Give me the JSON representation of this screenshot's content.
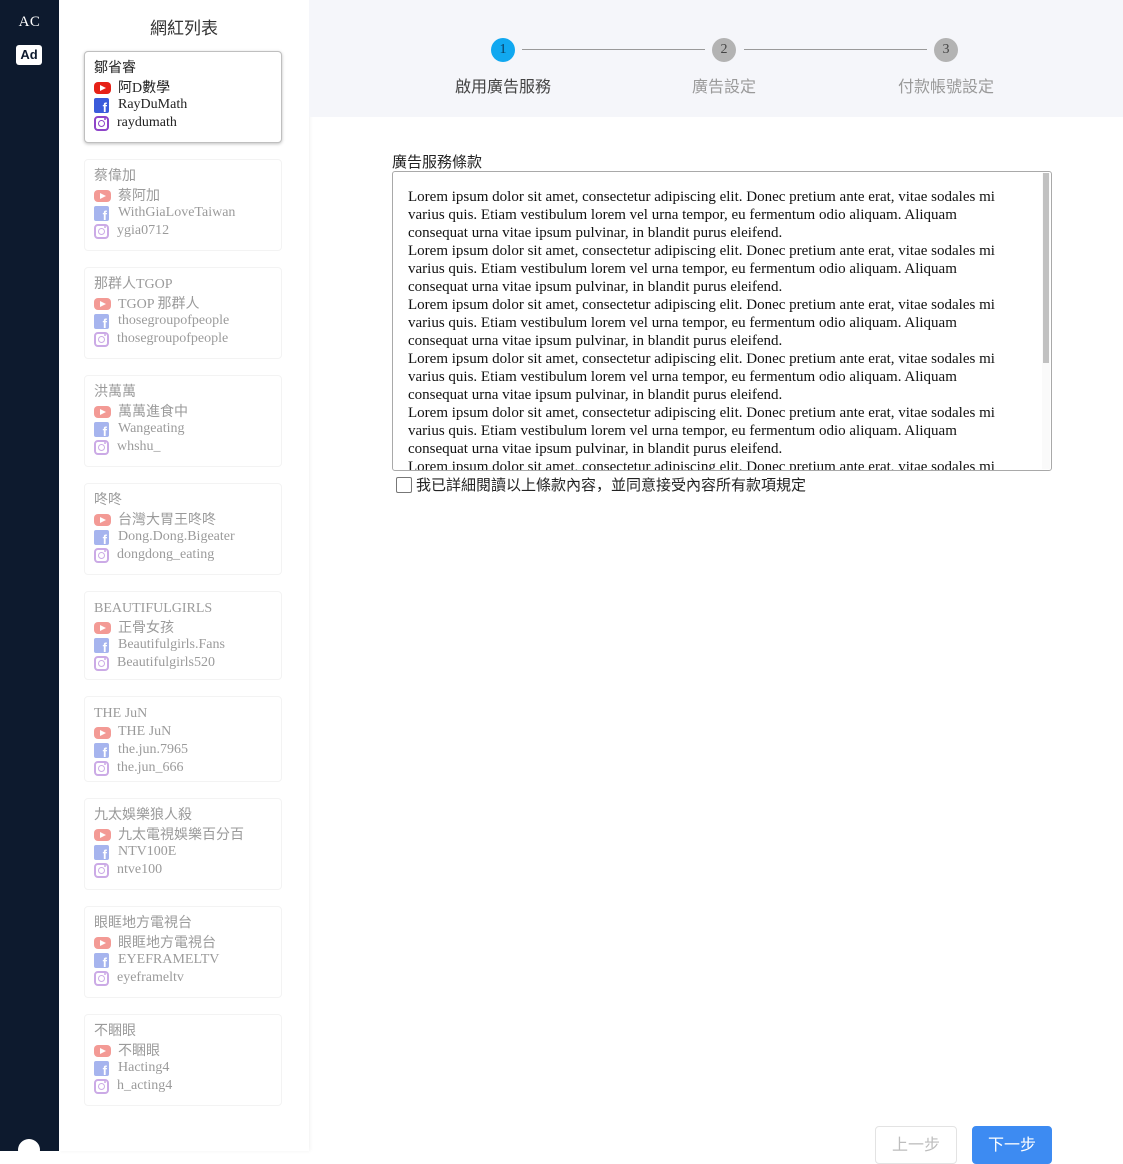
{
  "rail": {
    "title": "AC",
    "ad_badge": "Ad"
  },
  "list": {
    "title": "網紅列表",
    "cards": [
      {
        "name": "鄒省睿",
        "youtube": "阿D數學",
        "facebook": "RayDuMath",
        "instagram": "raydumath"
      },
      {
        "name": "蔡偉加",
        "youtube": "蔡阿加",
        "facebook": "WithGiaLoveTaiwan",
        "instagram": "ygia0712"
      },
      {
        "name": "那群人TGOP",
        "youtube": "TGOP 那群人",
        "facebook": "thosegroupofpeople",
        "instagram": "thosegroupofpeople"
      },
      {
        "name": "洪萬萬",
        "youtube": "萬萬進食中",
        "facebook": "Wangeating",
        "instagram": "whshu_"
      },
      {
        "name": "咚咚",
        "youtube": "台灣大胃王咚咚",
        "facebook": "Dong.Dong.Bigeater",
        "instagram": "dongdong_eating"
      },
      {
        "name": "BEAUTIFULGIRLS",
        "youtube": "正骨女孩",
        "facebook": "Beautifulgirls.Fans",
        "instagram": "Beautifulgirls520"
      },
      {
        "name": "THE JuN",
        "youtube": "THE JuN",
        "facebook": "the.jun.7965",
        "instagram": "the.jun_666"
      },
      {
        "name": "九太娛樂狼人殺",
        "youtube": "九太電視娛樂百分百",
        "facebook": "NTV100E",
        "instagram": "ntve100"
      },
      {
        "name": "眼眶地方電視台",
        "youtube": "眼眶地方電視台",
        "facebook": "EYEFRAMELTV",
        "instagram": "eyeframeltv"
      },
      {
        "name": "不睏眼",
        "youtube": "不睏眼",
        "facebook": "Hacting4",
        "instagram": "h_acting4"
      }
    ]
  },
  "stepper": {
    "steps": [
      {
        "number": "1",
        "label": "啟用廣告服務"
      },
      {
        "number": "2",
        "label": "廣告設定"
      },
      {
        "number": "3",
        "label": "付款帳號設定"
      }
    ]
  },
  "terms": {
    "title": "廣告服務條款",
    "paragraph": "Lorem ipsum dolor sit amet, consectetur adipiscing elit. Donec pretium ante erat, vitae sodales mi varius quis. Etiam vestibulum lorem vel urna tempor, eu fermentum odio aliquam. Aliquam consequat urna vitae ipsum pulvinar, in blandit purus eleifend.",
    "agree_label": "我已詳細閱讀以上條款內容，並同意接受內容所有款項規定"
  },
  "buttons": {
    "prev": "上一步",
    "next": "下一步"
  },
  "colors": {
    "rail": "#0d1a2e",
    "active_step": "#11a8f0",
    "primary_button": "#3d8bf2",
    "youtube": "#e62117",
    "facebook": "#3b5bdb",
    "instagram": "#8e44c9"
  }
}
